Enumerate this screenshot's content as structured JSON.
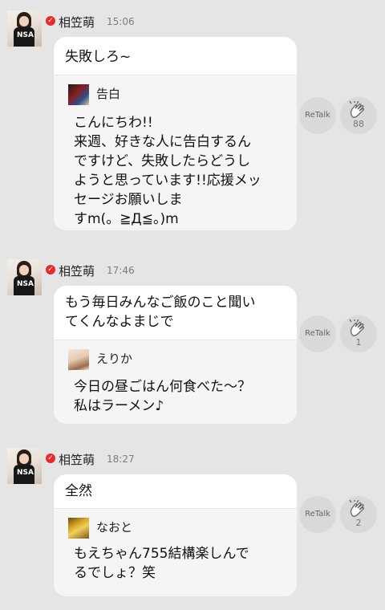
{
  "posts": [
    {
      "author": "相笠萌",
      "time": "15:06",
      "comment_lines": [
        "失敗しろ~"
      ],
      "quote": {
        "name": "告白",
        "text": "こんにちわ!!\n来週、好きな人に告白するん\nですけど、失敗したらどうし\nようと思っています!!応援メッ\nセージお願いしま\nすm(。≧Д≦。)m"
      },
      "retalk_label": "ReTalk",
      "clap_count": "88"
    },
    {
      "author": "相笠萌",
      "time": "17:46",
      "comment_lines": [
        "もう毎日みんなご飯のこと聞い",
        "てくんなよまじで"
      ],
      "quote": {
        "name": "えりか",
        "text": "今日の昼ごはん何食べた～？\n私はラーメン♪"
      },
      "retalk_label": "ReTalk",
      "clap_count": "1"
    },
    {
      "author": "相笠萌",
      "time": "18:27",
      "comment_lines": [
        "全然"
      ],
      "quote": {
        "name": "なおと",
        "text": "もえちゃん755結構楽しんで\nるでしょ？笑"
      },
      "retalk_label": "ReTalk",
      "clap_count": "2"
    }
  ],
  "avatar_logo": "NSA"
}
